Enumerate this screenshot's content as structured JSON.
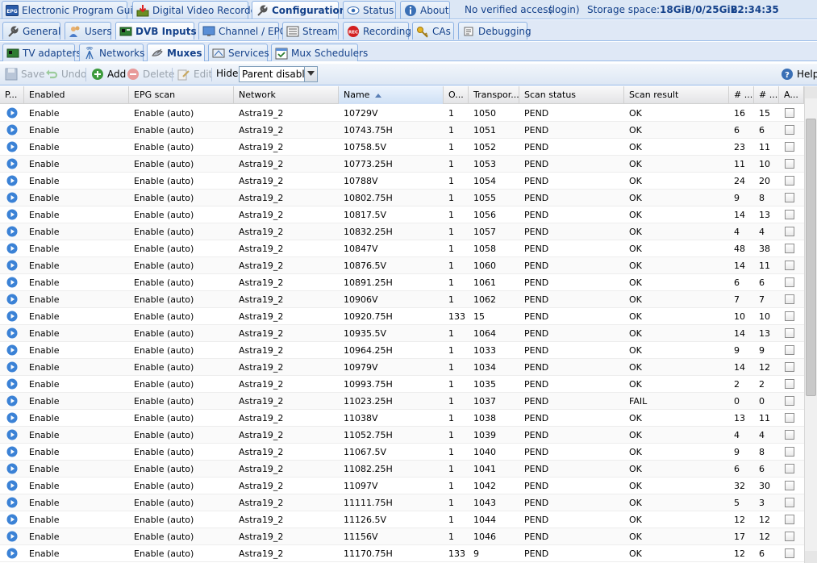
{
  "top_tabs": [
    {
      "label": "Electronic Program Guide",
      "icon": "epg-icon"
    },
    {
      "label": "Digital Video Recorder",
      "icon": "dvr-icon"
    },
    {
      "label": "Configuration",
      "icon": "wrench-icon",
      "active": true
    },
    {
      "label": "Status",
      "icon": "eye-icon"
    },
    {
      "label": "About",
      "icon": "info-icon"
    }
  ],
  "status": {
    "access": "No verified access",
    "login": "(login)",
    "storage_label": "Storage space:",
    "storage_value": "18GiB/0/25GiB",
    "clock": "22:34:35"
  },
  "config_tabs": [
    {
      "label": "General",
      "icon": "wrench-icon"
    },
    {
      "label": "Users",
      "icon": "users-icon"
    },
    {
      "label": "DVB Inputs",
      "icon": "tv-card-icon",
      "active": true
    },
    {
      "label": "Channel / EPG",
      "icon": "monitor-icon"
    },
    {
      "label": "Stream",
      "icon": "stream-icon"
    },
    {
      "label": "Recording",
      "icon": "rec-icon"
    },
    {
      "label": "CAs",
      "icon": "key-icon"
    },
    {
      "label": "Debugging",
      "icon": "bug-icon"
    }
  ],
  "dvb_tabs": [
    {
      "label": "TV adapters",
      "icon": "tv-card-icon"
    },
    {
      "label": "Networks",
      "icon": "antenna-icon"
    },
    {
      "label": "Muxes",
      "icon": "satellite-icon",
      "active": true
    },
    {
      "label": "Services",
      "icon": "services-icon"
    },
    {
      "label": "Mux Schedulers",
      "icon": "scheduler-icon"
    }
  ],
  "toolbar": {
    "save": "Save",
    "undo": "Undo",
    "add": "Add",
    "delete": "Delete",
    "edit": "Edit",
    "hide_label": "Hide:",
    "hide_value": "Parent disabled",
    "help": "Help"
  },
  "columns": [
    "P...",
    "Enabled",
    "EPG scan",
    "Network",
    "Name",
    "O...",
    "Transpor...",
    "Scan status",
    "Scan result",
    "# ...",
    "# ...",
    "A..."
  ],
  "rows": [
    {
      "enabled": "Enable",
      "epg": "Enable (auto)",
      "network": "Astra19_2",
      "name": "10729V",
      "onid": "1",
      "tsid": "1050",
      "scan_status": "PEND",
      "scan_result": "OK",
      "n1": "16",
      "n2": "15"
    },
    {
      "enabled": "Enable",
      "epg": "Enable (auto)",
      "network": "Astra19_2",
      "name": "10743.75H",
      "onid": "1",
      "tsid": "1051",
      "scan_status": "PEND",
      "scan_result": "OK",
      "n1": "6",
      "n2": "6"
    },
    {
      "enabled": "Enable",
      "epg": "Enable (auto)",
      "network": "Astra19_2",
      "name": "10758.5V",
      "onid": "1",
      "tsid": "1052",
      "scan_status": "PEND",
      "scan_result": "OK",
      "n1": "23",
      "n2": "11"
    },
    {
      "enabled": "Enable",
      "epg": "Enable (auto)",
      "network": "Astra19_2",
      "name": "10773.25H",
      "onid": "1",
      "tsid": "1053",
      "scan_status": "PEND",
      "scan_result": "OK",
      "n1": "11",
      "n2": "10"
    },
    {
      "enabled": "Enable",
      "epg": "Enable (auto)",
      "network": "Astra19_2",
      "name": "10788V",
      "onid": "1",
      "tsid": "1054",
      "scan_status": "PEND",
      "scan_result": "OK",
      "n1": "24",
      "n2": "20"
    },
    {
      "enabled": "Enable",
      "epg": "Enable (auto)",
      "network": "Astra19_2",
      "name": "10802.75H",
      "onid": "1",
      "tsid": "1055",
      "scan_status": "PEND",
      "scan_result": "OK",
      "n1": "9",
      "n2": "8"
    },
    {
      "enabled": "Enable",
      "epg": "Enable (auto)",
      "network": "Astra19_2",
      "name": "10817.5V",
      "onid": "1",
      "tsid": "1056",
      "scan_status": "PEND",
      "scan_result": "OK",
      "n1": "14",
      "n2": "13"
    },
    {
      "enabled": "Enable",
      "epg": "Enable (auto)",
      "network": "Astra19_2",
      "name": "10832.25H",
      "onid": "1",
      "tsid": "1057",
      "scan_status": "PEND",
      "scan_result": "OK",
      "n1": "4",
      "n2": "4"
    },
    {
      "enabled": "Enable",
      "epg": "Enable (auto)",
      "network": "Astra19_2",
      "name": "10847V",
      "onid": "1",
      "tsid": "1058",
      "scan_status": "PEND",
      "scan_result": "OK",
      "n1": "48",
      "n2": "38"
    },
    {
      "enabled": "Enable",
      "epg": "Enable (auto)",
      "network": "Astra19_2",
      "name": "10876.5V",
      "onid": "1",
      "tsid": "1060",
      "scan_status": "PEND",
      "scan_result": "OK",
      "n1": "14",
      "n2": "11"
    },
    {
      "enabled": "Enable",
      "epg": "Enable (auto)",
      "network": "Astra19_2",
      "name": "10891.25H",
      "onid": "1",
      "tsid": "1061",
      "scan_status": "PEND",
      "scan_result": "OK",
      "n1": "6",
      "n2": "6"
    },
    {
      "enabled": "Enable",
      "epg": "Enable (auto)",
      "network": "Astra19_2",
      "name": "10906V",
      "onid": "1",
      "tsid": "1062",
      "scan_status": "PEND",
      "scan_result": "OK",
      "n1": "7",
      "n2": "7"
    },
    {
      "enabled": "Enable",
      "epg": "Enable (auto)",
      "network": "Astra19_2",
      "name": "10920.75H",
      "onid": "133",
      "tsid": "15",
      "scan_status": "PEND",
      "scan_result": "OK",
      "n1": "10",
      "n2": "10"
    },
    {
      "enabled": "Enable",
      "epg": "Enable (auto)",
      "network": "Astra19_2",
      "name": "10935.5V",
      "onid": "1",
      "tsid": "1064",
      "scan_status": "PEND",
      "scan_result": "OK",
      "n1": "14",
      "n2": "13"
    },
    {
      "enabled": "Enable",
      "epg": "Enable (auto)",
      "network": "Astra19_2",
      "name": "10964.25H",
      "onid": "1",
      "tsid": "1033",
      "scan_status": "PEND",
      "scan_result": "OK",
      "n1": "9",
      "n2": "9"
    },
    {
      "enabled": "Enable",
      "epg": "Enable (auto)",
      "network": "Astra19_2",
      "name": "10979V",
      "onid": "1",
      "tsid": "1034",
      "scan_status": "PEND",
      "scan_result": "OK",
      "n1": "14",
      "n2": "12"
    },
    {
      "enabled": "Enable",
      "epg": "Enable (auto)",
      "network": "Astra19_2",
      "name": "10993.75H",
      "onid": "1",
      "tsid": "1035",
      "scan_status": "PEND",
      "scan_result": "OK",
      "n1": "2",
      "n2": "2"
    },
    {
      "enabled": "Enable",
      "epg": "Enable (auto)",
      "network": "Astra19_2",
      "name": "11023.25H",
      "onid": "1",
      "tsid": "1037",
      "scan_status": "PEND",
      "scan_result": "FAIL",
      "n1": "0",
      "n2": "0"
    },
    {
      "enabled": "Enable",
      "epg": "Enable (auto)",
      "network": "Astra19_2",
      "name": "11038V",
      "onid": "1",
      "tsid": "1038",
      "scan_status": "PEND",
      "scan_result": "OK",
      "n1": "13",
      "n2": "11"
    },
    {
      "enabled": "Enable",
      "epg": "Enable (auto)",
      "network": "Astra19_2",
      "name": "11052.75H",
      "onid": "1",
      "tsid": "1039",
      "scan_status": "PEND",
      "scan_result": "OK",
      "n1": "4",
      "n2": "4"
    },
    {
      "enabled": "Enable",
      "epg": "Enable (auto)",
      "network": "Astra19_2",
      "name": "11067.5V",
      "onid": "1",
      "tsid": "1040",
      "scan_status": "PEND",
      "scan_result": "OK",
      "n1": "9",
      "n2": "8"
    },
    {
      "enabled": "Enable",
      "epg": "Enable (auto)",
      "network": "Astra19_2",
      "name": "11082.25H",
      "onid": "1",
      "tsid": "1041",
      "scan_status": "PEND",
      "scan_result": "OK",
      "n1": "6",
      "n2": "6"
    },
    {
      "enabled": "Enable",
      "epg": "Enable (auto)",
      "network": "Astra19_2",
      "name": "11097V",
      "onid": "1",
      "tsid": "1042",
      "scan_status": "PEND",
      "scan_result": "OK",
      "n1": "32",
      "n2": "30"
    },
    {
      "enabled": "Enable",
      "epg": "Enable (auto)",
      "network": "Astra19_2",
      "name": "11111.75H",
      "onid": "1",
      "tsid": "1043",
      "scan_status": "PEND",
      "scan_result": "OK",
      "n1": "5",
      "n2": "3"
    },
    {
      "enabled": "Enable",
      "epg": "Enable (auto)",
      "network": "Astra19_2",
      "name": "11126.5V",
      "onid": "1",
      "tsid": "1044",
      "scan_status": "PEND",
      "scan_result": "OK",
      "n1": "12",
      "n2": "12"
    },
    {
      "enabled": "Enable",
      "epg": "Enable (auto)",
      "network": "Astra19_2",
      "name": "11156V",
      "onid": "1",
      "tsid": "1046",
      "scan_status": "PEND",
      "scan_result": "OK",
      "n1": "17",
      "n2": "12"
    },
    {
      "enabled": "Enable",
      "epg": "Enable (auto)",
      "network": "Astra19_2",
      "name": "11170.75H",
      "onid": "133",
      "tsid": "9",
      "scan_status": "PEND",
      "scan_result": "OK",
      "n1": "12",
      "n2": "6"
    }
  ],
  "colors": {
    "tab_text": "#15428b",
    "header_bg": "#dfe8f6",
    "border": "#99bbe8",
    "play": "#3b82d6"
  }
}
